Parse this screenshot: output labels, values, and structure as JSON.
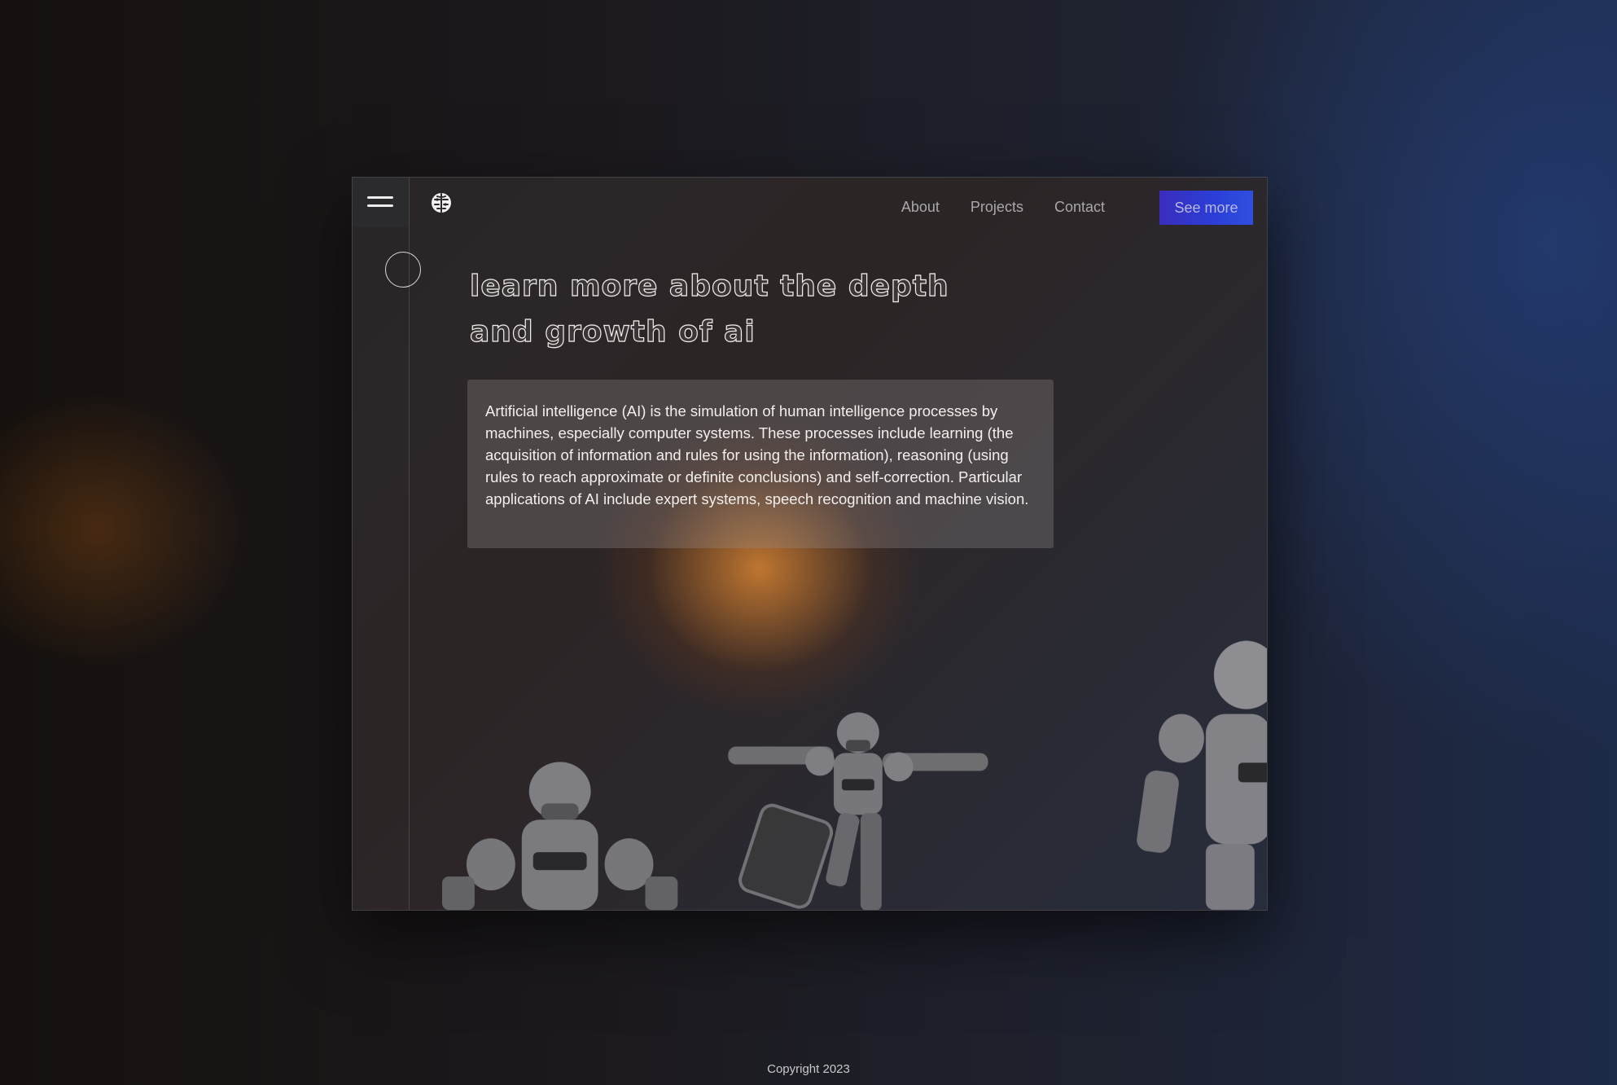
{
  "header": {
    "menu_icon": "hamburger-menu-icon",
    "logo_icon": "brain-logo-icon",
    "nav": [
      {
        "label": "About"
      },
      {
        "label": "Projects"
      },
      {
        "label": "Contact"
      }
    ],
    "cta_label": "See more"
  },
  "hero": {
    "headline_line1": "learn more about the depth",
    "headline_line2": "and growth of ai",
    "description": "Artificial intelligence (AI) is the simulation of human intelligence processes by machines, especially computer systems. These processes include learning (the acquisition of information and rules for using the information), reasoning (using rules to reach approximate or definite conclusions) and self-correction. Particular applications of AI include expert systems, speech recognition and machine vision."
  },
  "footer": {
    "copyright": "Copyright 2023"
  },
  "colors": {
    "accent": "#2f45d8",
    "glow": "#e88c32"
  }
}
